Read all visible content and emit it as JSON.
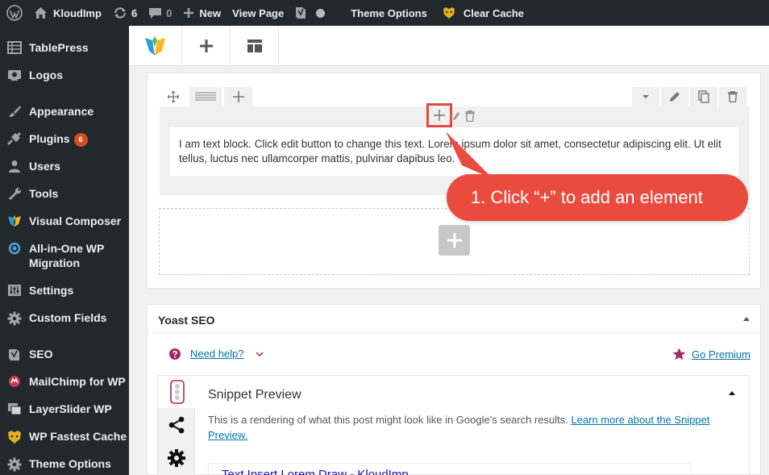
{
  "adminbar": {
    "site_name": "KloudImp",
    "updates_count": "6",
    "comments_count": "0",
    "new_label": "New",
    "view_page_label": "View Page",
    "theme_options_label": "Theme Options",
    "clear_cache_label": "Clear Cache"
  },
  "sidebar": {
    "items": [
      {
        "label": "TablePress",
        "icon": "table-icon"
      },
      {
        "label": "Logos",
        "icon": "logo-icon"
      },
      {
        "label": "Appearance",
        "icon": "brush-icon"
      },
      {
        "label": "Plugins",
        "icon": "plugin-icon",
        "badge": "6"
      },
      {
        "label": "Users",
        "icon": "user-icon"
      },
      {
        "label": "Tools",
        "icon": "wrench-icon"
      },
      {
        "label": "Visual Composer",
        "icon": "visual-composer-icon"
      },
      {
        "label": "All-in-One WP Migration",
        "icon": "migration-icon"
      },
      {
        "label": "Settings",
        "icon": "settings-icon"
      },
      {
        "label": "Custom Fields",
        "icon": "gear-icon"
      },
      {
        "label": "SEO",
        "icon": "yoast-icon"
      },
      {
        "label": "MailChimp for WP",
        "icon": "mailchimp-icon"
      },
      {
        "label": "LayerSlider WP",
        "icon": "layers-icon"
      },
      {
        "label": "WP Fastest Cache",
        "icon": "cheetah-icon"
      },
      {
        "label": "Theme Options",
        "icon": "gear-icon"
      }
    ]
  },
  "editor": {
    "text_block": "I am text block. Click edit button to change this text. Lorem ipsum dolor sit amet, consectetur adipiscing elit. Ut elit tellus, luctus nec ullamcorper mattis, pulvinar dapibus leo."
  },
  "callout": {
    "text": "1. Click “+” to add an element"
  },
  "yoast": {
    "title": "Yoast SEO",
    "need_help": "Need help?",
    "go_premium": "Go Premium",
    "snippet_title": "Snippet Preview",
    "snippet_desc": "This is a rendering of what this post might look like in Google's search results.",
    "snippet_link": "Learn more about the Snippet Preview.",
    "snippet_preview_title": "Text Insert Lorem Draw - KloudImp"
  },
  "colors": {
    "adminbar_bg": "#23282d",
    "callout_bg": "#e94c3f",
    "link": "#0073aa",
    "premium_star": "#a4286a"
  }
}
